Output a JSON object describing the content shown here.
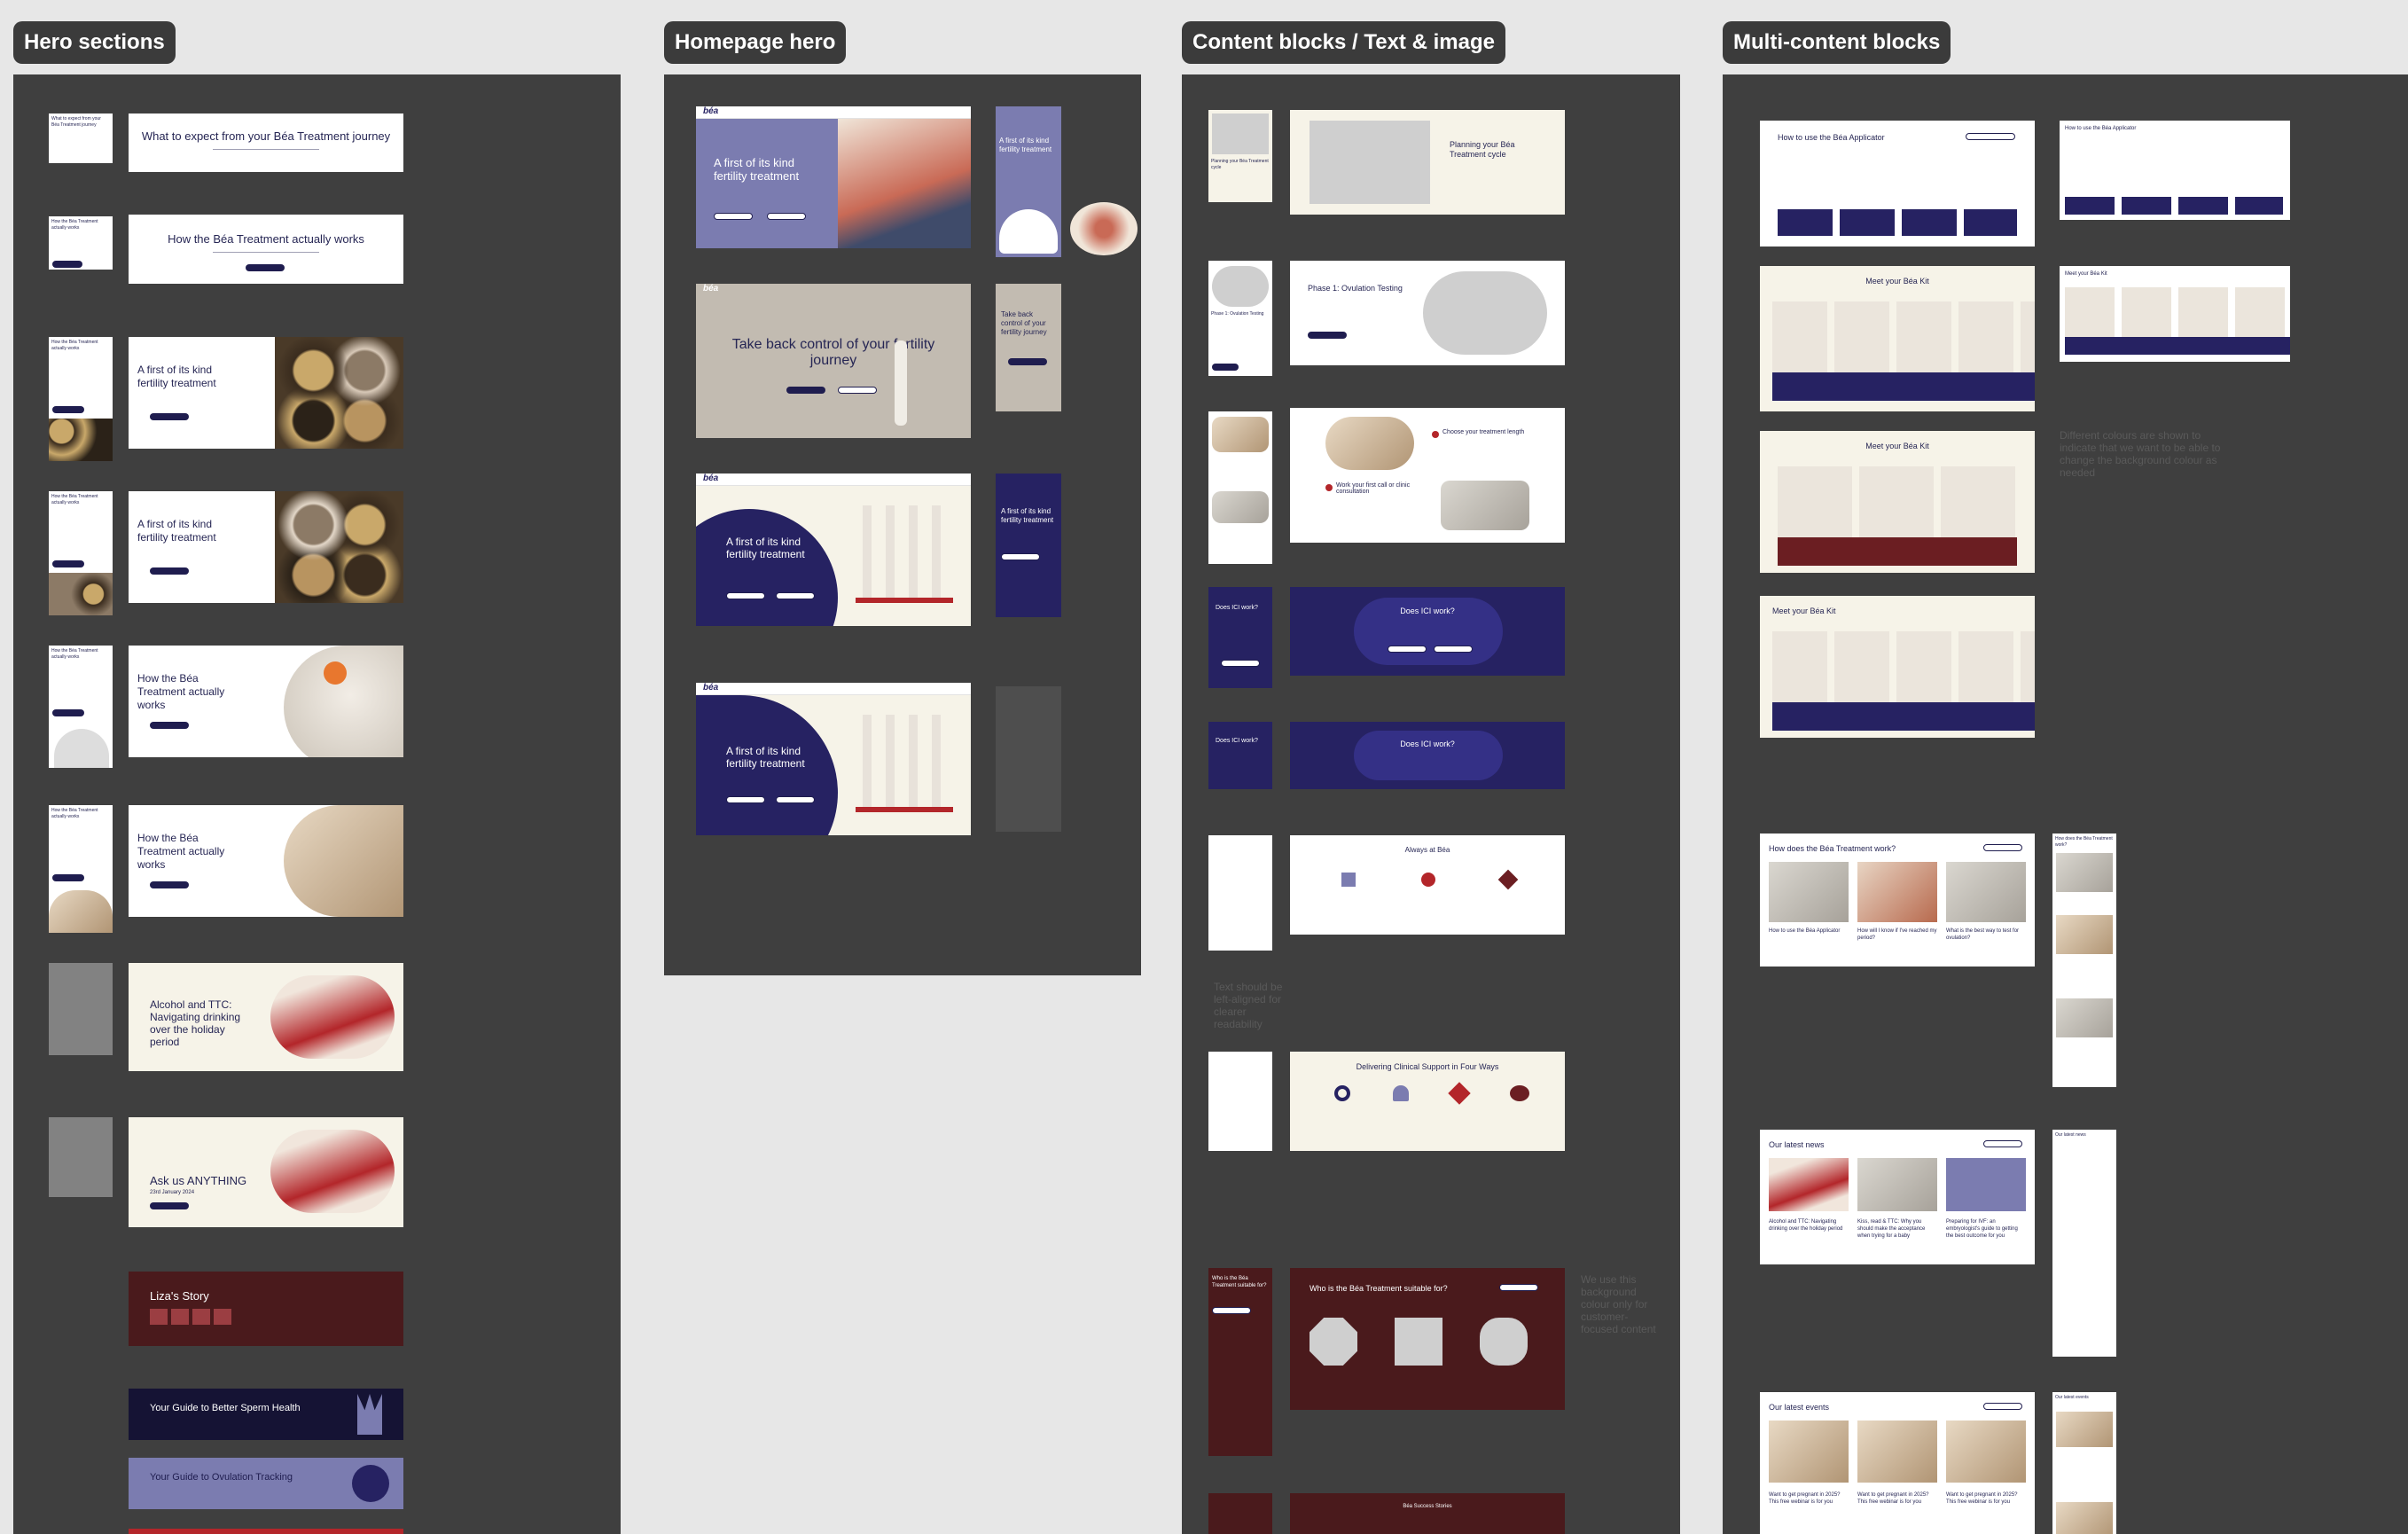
{
  "labels": {
    "hero_sections": "Hero sections",
    "homepage_hero": "Homepage hero",
    "content_blocks": "Content blocks / Text & image",
    "multi_content": "Multi-content blocks"
  },
  "hero": {
    "expect_title": "What to expect from your Béa Treatment journey",
    "how_title": "How the Béa Treatment actually works",
    "first_title": "A first of its kind fertility treatment",
    "how_title_2": "How the Béa Treatment actually works",
    "alcohol_title": "Alcohol and TTC: Navigating drinking over the holiday period",
    "ask_title": "Ask us ANYTHING",
    "ask_date": "23rd January 2024",
    "liza_title": "Liza's Story",
    "sperm_title": "Your Guide to Better Sperm Health",
    "ovulation_title": "Your Guide to Ovulation Tracking"
  },
  "homepage": {
    "first_title": "A first of its kind fertility treatment",
    "take_back_title": "Take back control of your fertility journey",
    "mobile_first": "A first of its kind fertility treatment",
    "mobile_take_back": "Take back control of your fertility journey",
    "logo": "béa"
  },
  "content": {
    "planning_title": "Planning your Béa Treatment cycle",
    "phase_title": "Phase 1: Ovulation Testing",
    "choose_title": "Choose your treatment length",
    "work_title": "Work your first call or clinic consultation",
    "ici_title": "Does ICI work?",
    "always_title": "Always at Béa",
    "delivering_title": "Delivering Clinical Support in Four Ways",
    "suitable_title": "Who is the Béa Treatment suitable for?",
    "note_left_aligned": "Text should be left-aligned for clearer readability",
    "note_background": "We use this background colour only for customer-focused content",
    "reviews_title": "Béa Success Stories"
  },
  "multi": {
    "applicator_title": "How to use the Béa Applicator",
    "kit_title": "Meet your Béa Kit",
    "works_title": "How does the Béa Treatment work?",
    "news_title": "Our latest news",
    "events_title": "Our latest events",
    "note_colours": "Different colours are shown to indicate that we want to be able to change the background colour as needed",
    "works_cards": [
      "How to use the Béa Applicator",
      "How will I know if I've reached my period?",
      "What is the best way to test for ovulation?"
    ],
    "news_cards": [
      "Alcohol and TTC: Navigating drinking over the holiday period",
      "Kiss, read & TTC: Why you should make the acceptance when trying for a baby",
      "Preparing for IVF: an embryologist's guide to getting the best outcome for you"
    ],
    "events_cards": [
      "Want to get pregnant in 2025? This free webinar is for you",
      "Want to get pregnant in 2025? This free webinar is for you",
      "Want to get pregnant in 2025? This free webinar is for you"
    ]
  },
  "colors": {
    "navy": "#262262",
    "periwinkle": "#7b7cb0",
    "cream": "#f6f3e8",
    "maroon": "#4a1a1c",
    "panel": "#3f3f3f"
  }
}
